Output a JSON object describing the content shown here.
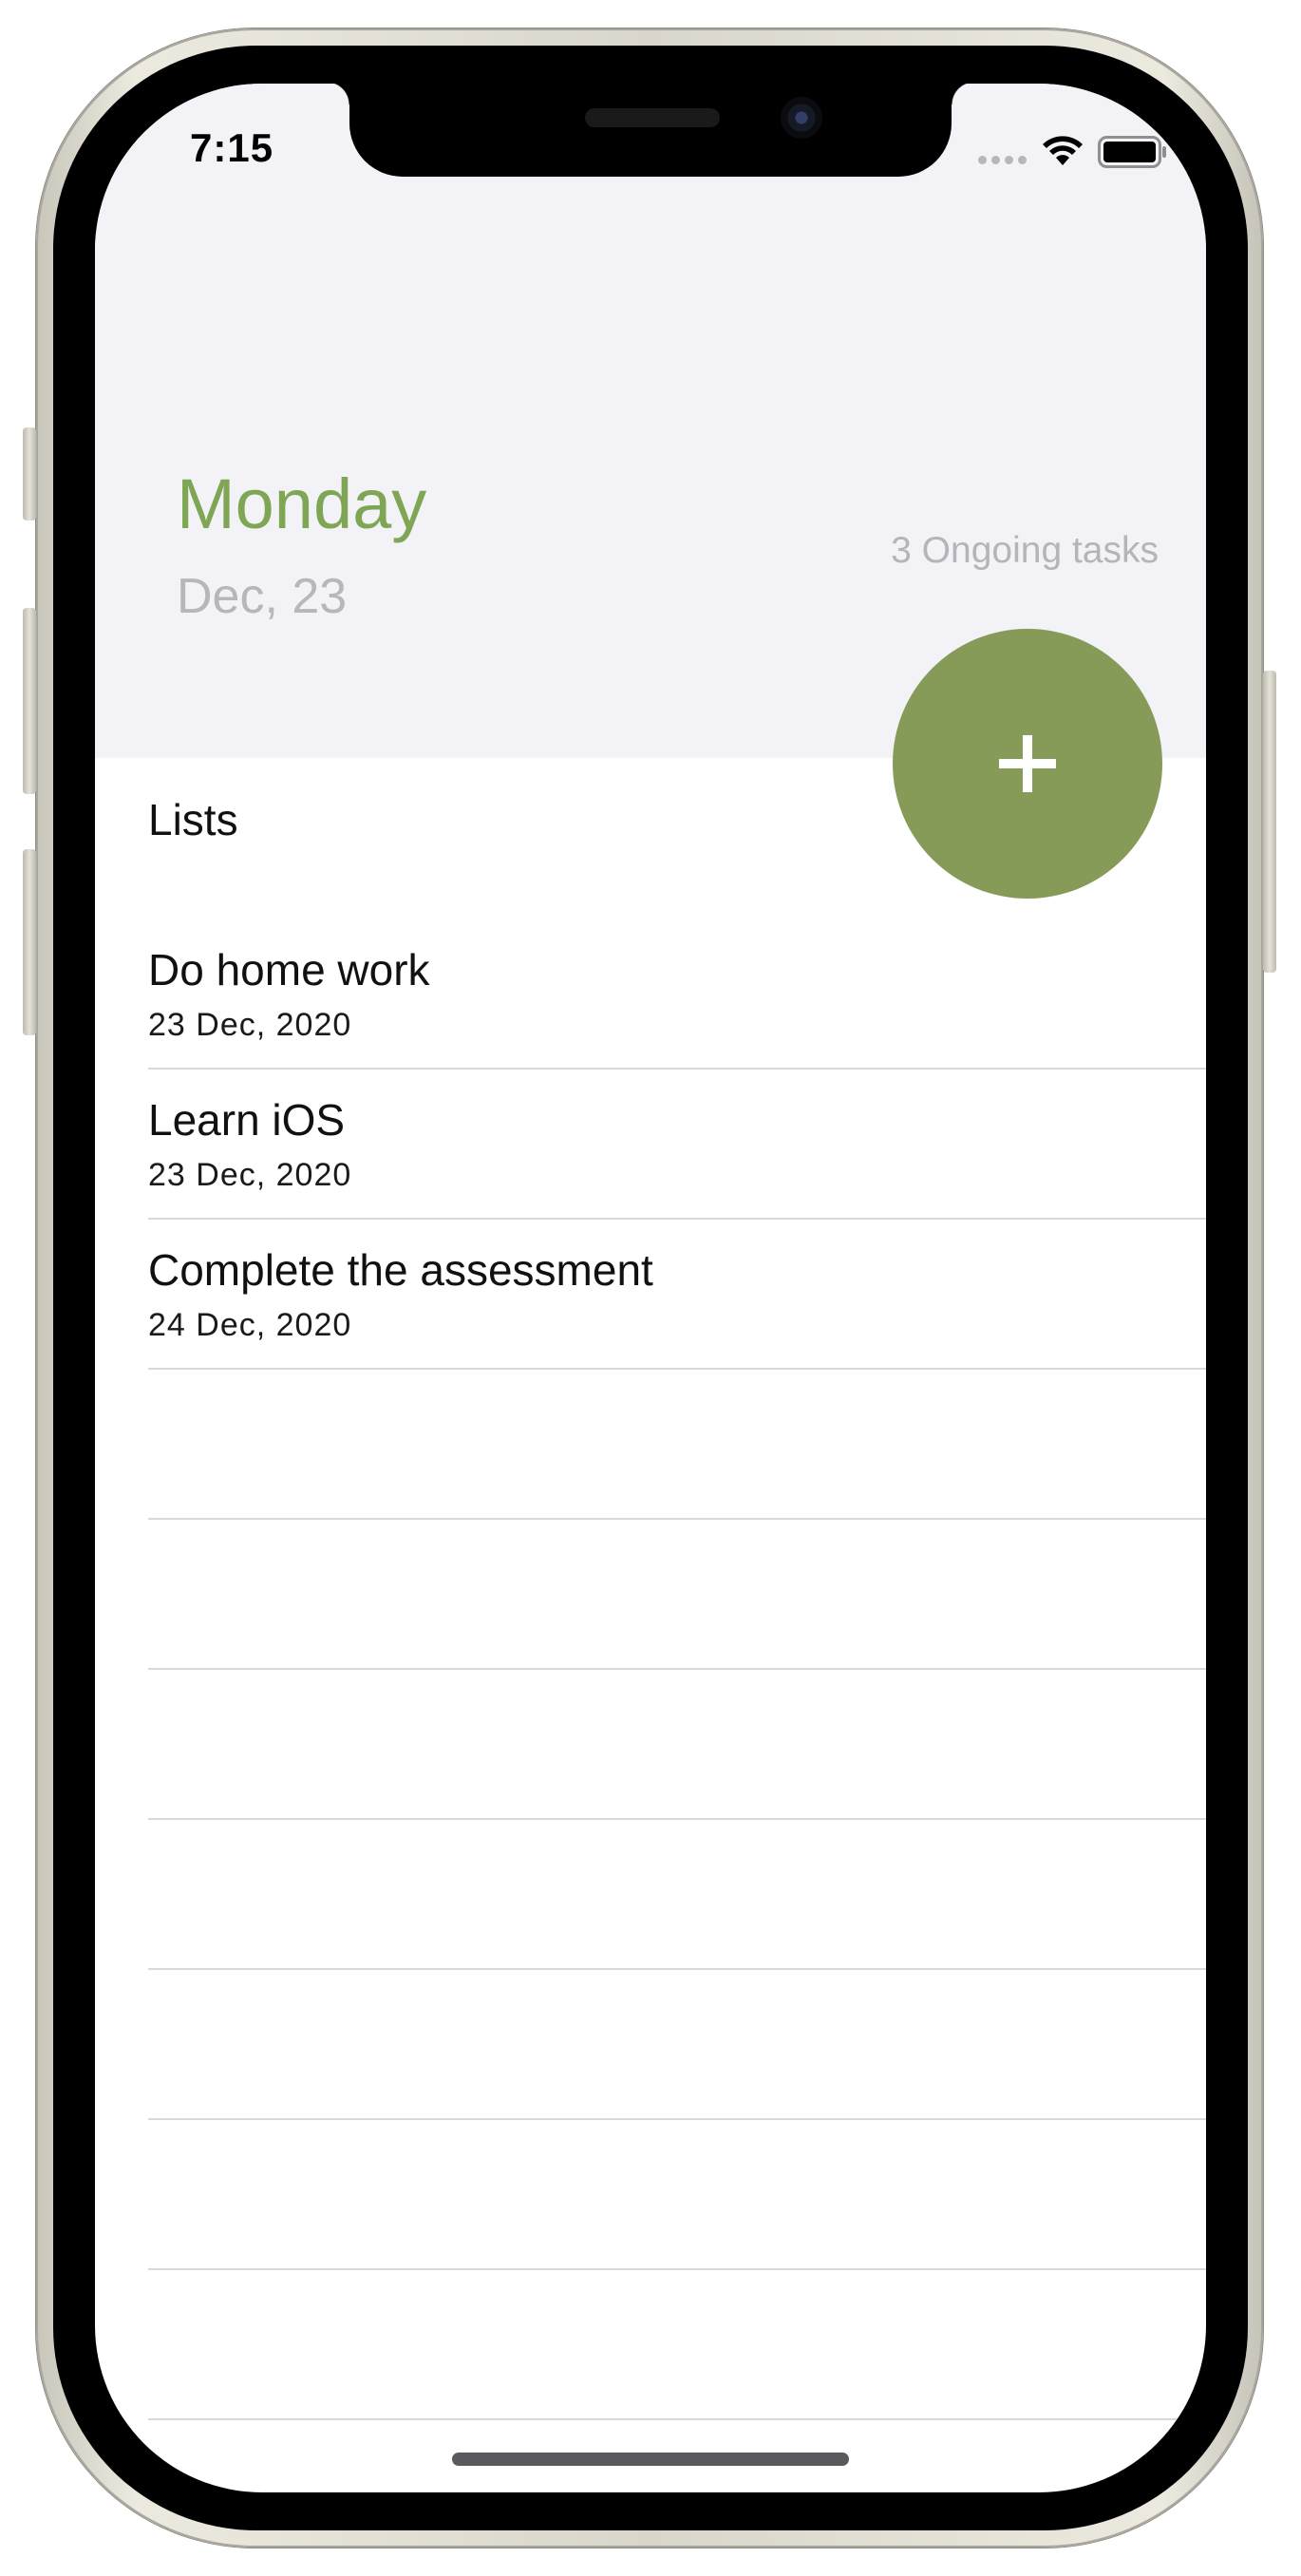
{
  "status_bar": {
    "time": "7:15",
    "signal_icon": "signal-dots-icon",
    "wifi_icon": "wifi-icon",
    "battery_icon": "battery-icon"
  },
  "header": {
    "day": "Monday",
    "date": "Dec, 23",
    "ongoing": "3 Ongoing tasks",
    "accent_color": "#7ea655"
  },
  "fab": {
    "icon": "plus-icon",
    "color": "#879b58"
  },
  "section": {
    "title": "Lists"
  },
  "tasks": [
    {
      "title": "Do home work",
      "date": "23 Dec, 2020"
    },
    {
      "title": "Learn iOS",
      "date": "23 Dec, 2020"
    },
    {
      "title": "Complete the assessment",
      "date": "24 Dec, 2020"
    }
  ]
}
